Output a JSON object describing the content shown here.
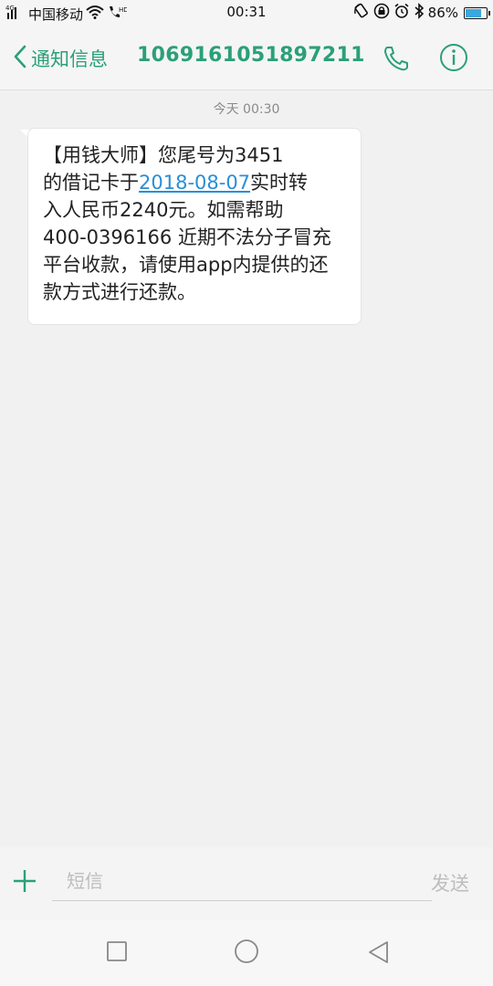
{
  "status_bar": {
    "network": "4G",
    "carrier": "中国移动",
    "hd": "HD",
    "time": "00:31",
    "battery_percent": "86%",
    "battery_level": 0.86,
    "icons": [
      "signal-icon",
      "wifi-icon",
      "hd-call-icon",
      "rotation-lock-icon",
      "lock-icon",
      "alarm-icon",
      "bluetooth-icon",
      "battery-icon"
    ]
  },
  "header": {
    "back_label": "通知信息",
    "title": "1069161051897211",
    "accent_color": "#2aa079"
  },
  "thread": {
    "timestamp": "今天 00:30",
    "message": {
      "line1": "【用钱大师】您尾号为3451",
      "line2_before": "的借记卡于",
      "line2_date": "2018-08-07",
      "line2_after": "实时转",
      "line3": "入人民币2240元。如需帮助",
      "line4": "400-0396166 近期不法分子冒充",
      "line5": "平台收款，请使用app内提供的还",
      "line6": "款方式进行还款。"
    }
  },
  "compose": {
    "placeholder": "短信",
    "send_label": "发送"
  },
  "navbar": {
    "items": [
      "recents-button",
      "home-button",
      "back-button"
    ]
  }
}
